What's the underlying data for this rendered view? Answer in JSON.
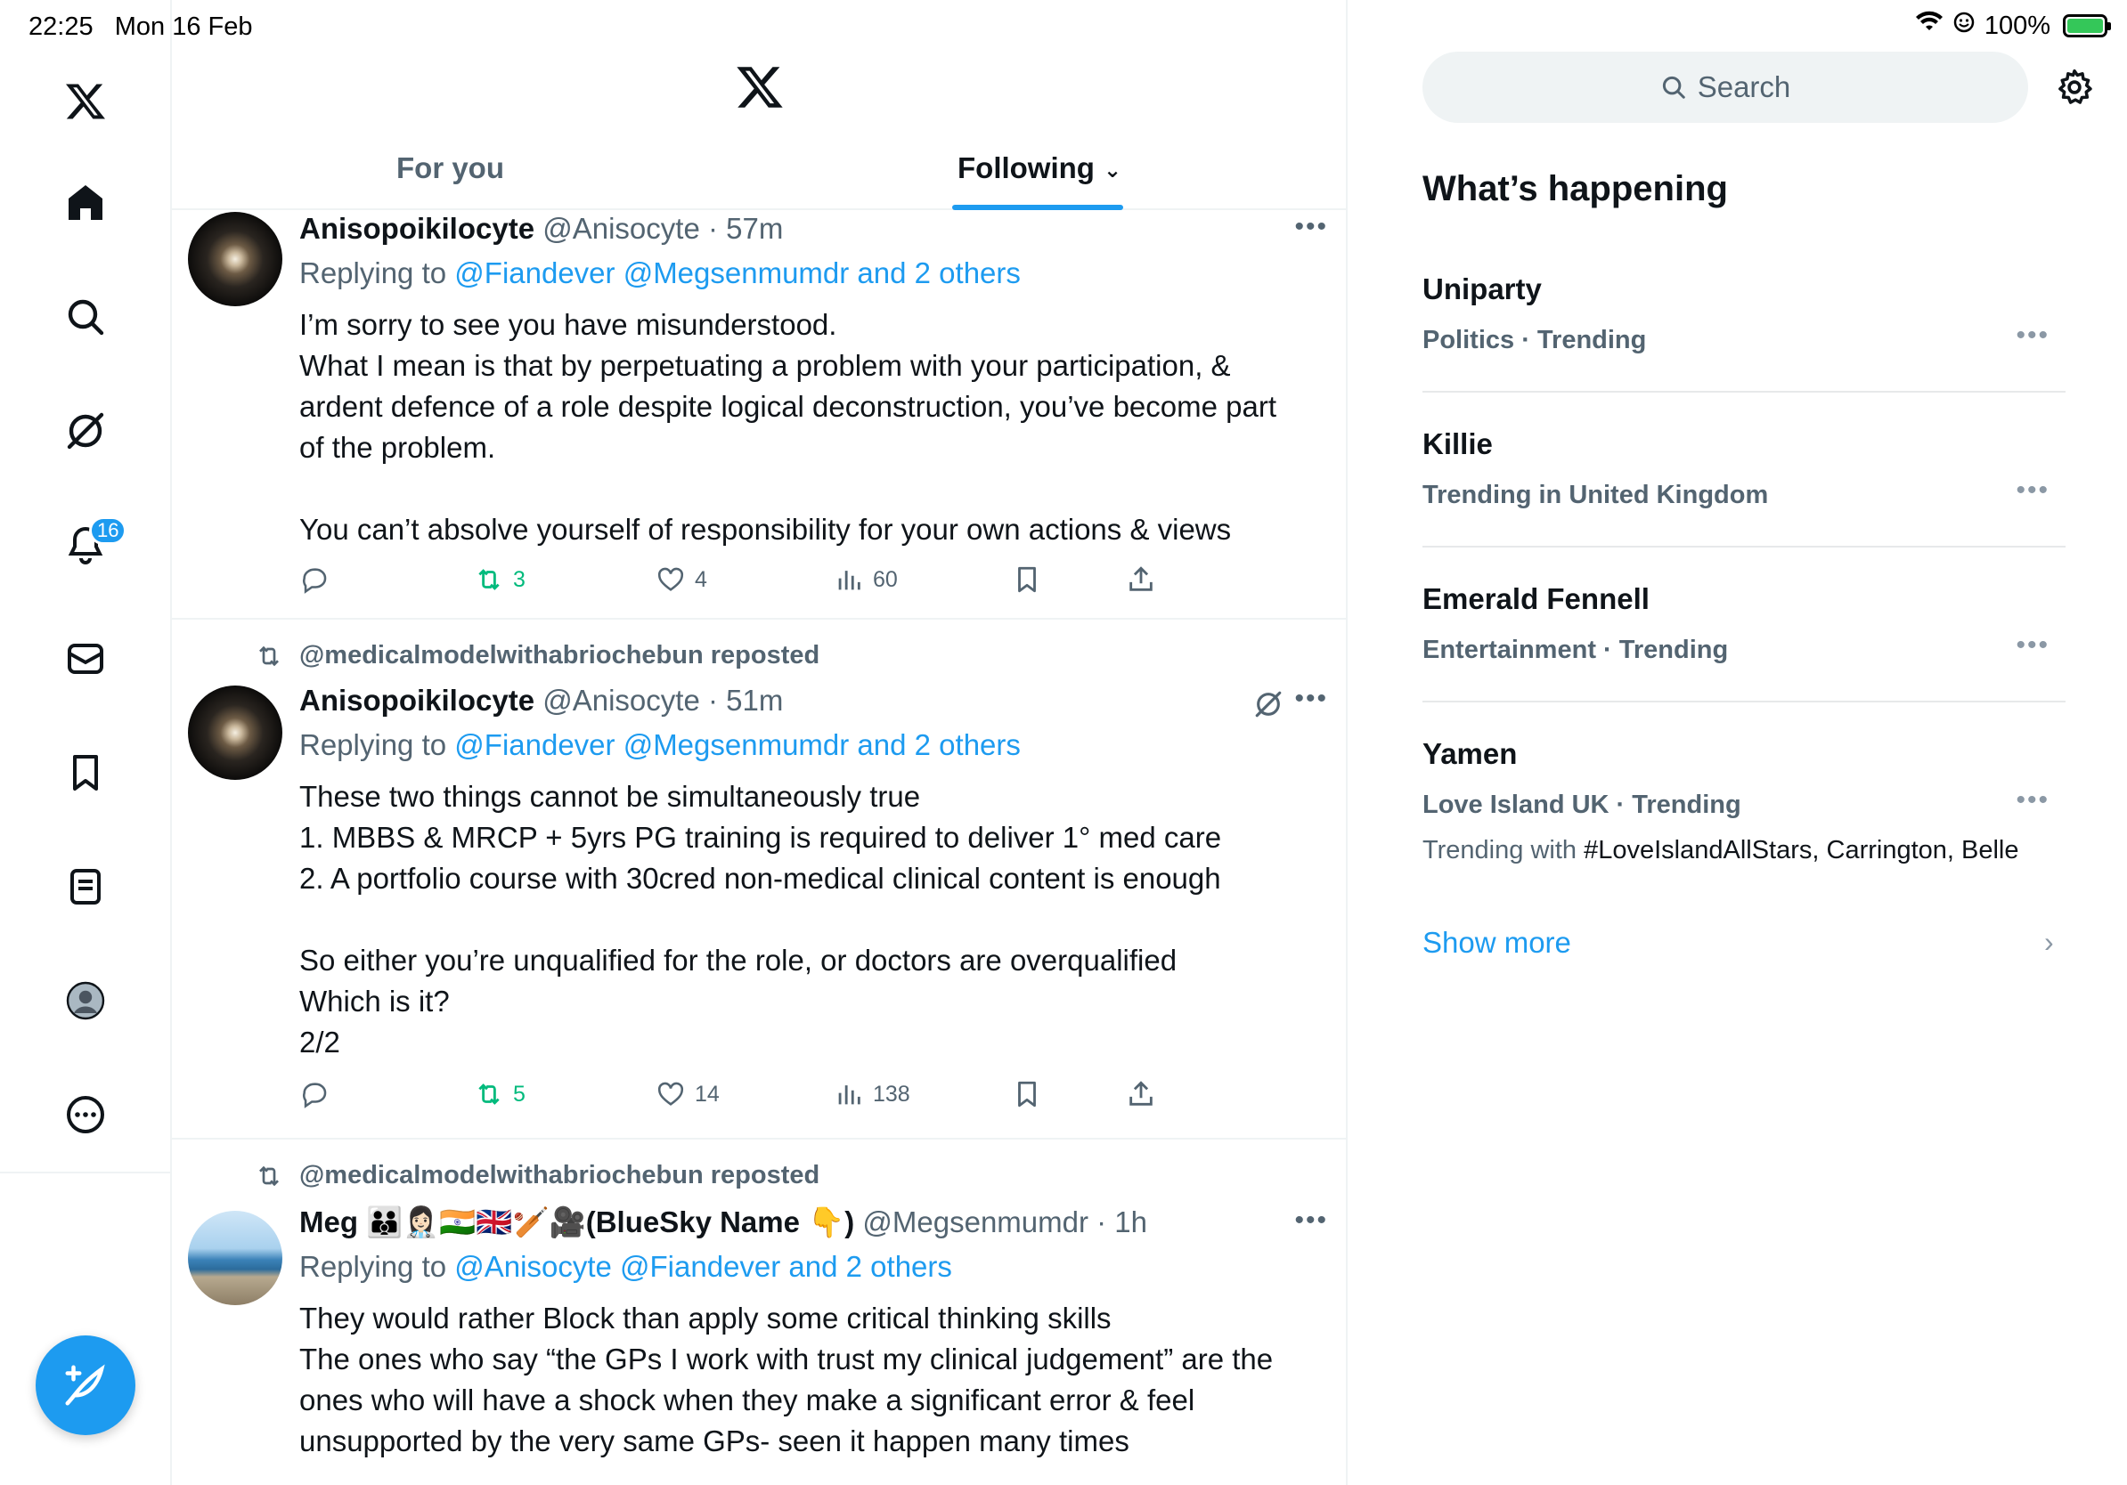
{
  "status_bar": {
    "time": "22:25",
    "date": "Mon 16 Feb",
    "battery": "100%"
  },
  "nav": {
    "items": [
      "x-logo",
      "home",
      "explore",
      "grok",
      "notifications",
      "messages",
      "bookmarks",
      "lists",
      "profile",
      "more"
    ],
    "notifications_badge": "16",
    "compose_label": "Post"
  },
  "tabs": {
    "for_you": "For you",
    "following": "Following"
  },
  "tweets": [
    {
      "name": "Anisopoikilocyte",
      "handle": "@Anisocyte",
      "time": "57m",
      "replying_prefix": "Replying to",
      "replying_to": "@Fiandever @Megsenmumdr and 2 others",
      "lines": [
        "I’m sorry to see you have misunderstood.",
        "What I mean is that by perpetuating a problem with your participation, &",
        "ardent defence of a role despite logical deconstruction, you’ve become part",
        "of the problem.",
        "",
        "You can’t absolve yourself of responsibility for your own actions & views"
      ],
      "reposts": "3",
      "likes": "4",
      "views": "60"
    },
    {
      "reposted_by": "@medicalmodelwithabriochebun reposted",
      "name": "Anisopoikilocyte",
      "handle": "@Anisocyte",
      "time": "51m",
      "replying_prefix": "Replying to",
      "replying_to": "@Fiandever @Megsenmumdr and 2 others",
      "lines": [
        "These two things cannot be simultaneously true",
        "1. MBBS & MRCP + 5yrs PG training is required to deliver 1° med care",
        "2. A portfolio course with 30cred non-medical clinical content is enough",
        "",
        "So either you’re unqualified for the role, or doctors are overqualified",
        "Which is it?",
        "2/2"
      ],
      "reposts": "5",
      "likes": "14",
      "views": "138"
    },
    {
      "reposted_by": "@medicalmodelwithabriochebun reposted",
      "name": "Meg 🧑‍🧑‍🧒👩🏻‍⚕️🇮🇳🇬🇧🏏🎥(BlueSky Name 👇)",
      "handle": "@Megsenmumdr",
      "time": "1h",
      "replying_prefix": "Replying to",
      "replying_to": "@Anisocyte @Fiandever and 2 others",
      "lines": [
        "They would rather Block than apply some critical thinking skills",
        "The ones who say “the GPs I work with trust my clinical judgement” are the",
        "ones who will have a shock when they make a significant error & feel",
        "unsupported by the very same GPs- seen it happen many times"
      ]
    }
  ],
  "sidebar": {
    "search_placeholder": "Search",
    "whats_happening": "What’s happening",
    "trends": [
      {
        "name": "Uniparty",
        "category": "Politics · Trending"
      },
      {
        "name": "Killie",
        "category": "Trending in United Kingdom"
      },
      {
        "name": "Emerald Fennell",
        "category": "Entertainment · Trending"
      },
      {
        "name": "Yamen",
        "category": "Love Island UK · Trending",
        "with_prefix": "Trending with",
        "with_tags": "#LoveIslandAllStars, Carrington, Belle"
      }
    ],
    "show_more": "Show more"
  },
  "colors": {
    "accent": "#1d9bf0",
    "repost_green": "#00ba7c",
    "secondary_text": "#536471"
  }
}
